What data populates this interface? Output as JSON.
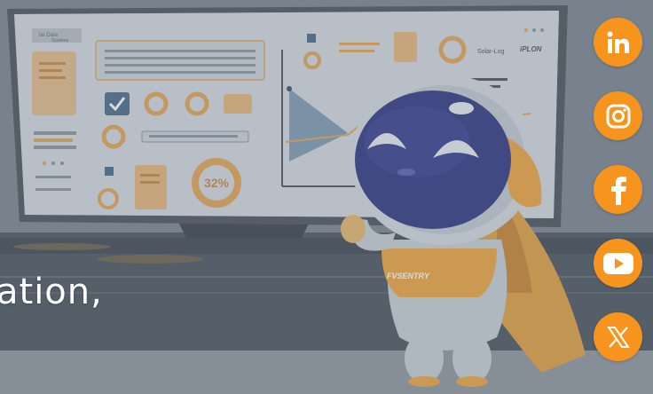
{
  "hero": {
    "partial_heading": "ation,",
    "screen_logo_text": [
      "lar Data",
      "Systems"
    ],
    "screen_percent": "32%",
    "screen_brands": [
      "Solar-Log",
      "iPLON"
    ],
    "robot_badge": "FVSENTRY"
  },
  "social": {
    "accent_color": "#f7941d",
    "links": [
      {
        "name": "linkedin",
        "icon": "linkedin-icon"
      },
      {
        "name": "instagram",
        "icon": "instagram-icon"
      },
      {
        "name": "facebook",
        "icon": "facebook-icon"
      },
      {
        "name": "youtube",
        "icon": "youtube-icon"
      },
      {
        "name": "x",
        "icon": "x-icon"
      }
    ]
  },
  "colors": {
    "overlay": "#6f7a86",
    "orange": "#f2a640",
    "robot_visor": "#3a3f86",
    "monitor_frame": "#4c5560"
  }
}
